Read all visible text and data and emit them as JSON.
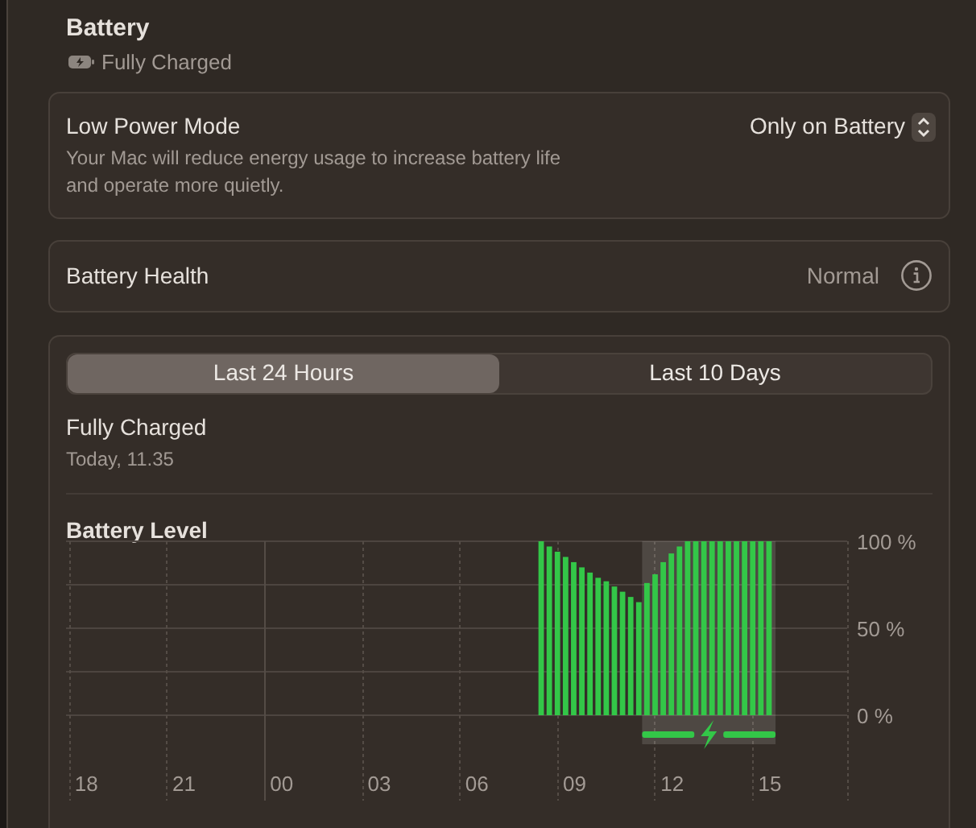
{
  "header": {
    "title": "Battery",
    "status": "Fully Charged"
  },
  "low_power_mode": {
    "label": "Low Power Mode",
    "description": "Your Mac will reduce energy usage to increase battery life and operate more quietly.",
    "value": "Only on Battery"
  },
  "battery_health": {
    "label": "Battery Health",
    "value": "Normal"
  },
  "history": {
    "tabs": [
      {
        "label": "Last 24 Hours",
        "selected": true
      },
      {
        "label": "Last 10 Days",
        "selected": false
      }
    ],
    "status": "Fully Charged",
    "time": "Today, 11.35",
    "chart_data": {
      "type": "bar",
      "title": "Battery Level",
      "categories": [
        null,
        null,
        "18",
        null,
        null,
        null,
        null,
        null,
        null,
        null,
        null,
        null,
        null,
        null,
        "21",
        null,
        null,
        null,
        null,
        null,
        null,
        null,
        null,
        null,
        null,
        null,
        "00",
        null,
        null,
        null,
        null,
        null,
        null,
        null,
        null,
        null,
        null,
        null,
        "03",
        null,
        null,
        null,
        null,
        null,
        null,
        null,
        null,
        null,
        null,
        null,
        "06",
        null,
        null,
        null,
        null,
        null,
        null,
        null,
        null,
        null,
        null,
        null,
        "09",
        null,
        null,
        null,
        null,
        null,
        null,
        null,
        null,
        null,
        null,
        null,
        "12",
        null,
        null,
        null,
        null,
        null,
        null,
        null,
        null,
        null,
        null,
        null,
        "15",
        null,
        null,
        null,
        null,
        null,
        null,
        null,
        null,
        null
      ],
      "series": [
        {
          "color": "#33c748",
          "values": [
            null,
            null,
            null,
            null,
            null,
            null,
            null,
            null,
            null,
            null,
            null,
            null,
            null,
            null,
            null,
            null,
            null,
            null,
            null,
            null,
            null,
            null,
            null,
            null,
            null,
            null,
            null,
            null,
            null,
            null,
            null,
            null,
            null,
            null,
            null,
            null,
            null,
            null,
            null,
            null,
            null,
            null,
            null,
            null,
            null,
            null,
            null,
            null,
            null,
            null,
            null,
            null,
            null,
            null,
            null,
            null,
            null,
            null,
            100,
            97,
            94,
            91,
            88,
            85,
            82,
            79,
            77,
            74,
            71,
            68,
            65,
            76,
            81,
            88,
            93,
            97,
            100,
            100,
            100,
            100,
            100,
            100,
            100,
            100,
            100,
            100,
            100,
            null,
            null,
            null,
            null,
            null,
            null,
            null,
            null,
            null
          ]
        }
      ],
      "ylim": [
        0,
        100
      ],
      "yticks": [
        {
          "value": 0,
          "label": "0 %"
        },
        {
          "value": 50,
          "label": "50 %"
        },
        {
          "value": 100,
          "label": "100 %"
        }
      ]
    }
  }
}
